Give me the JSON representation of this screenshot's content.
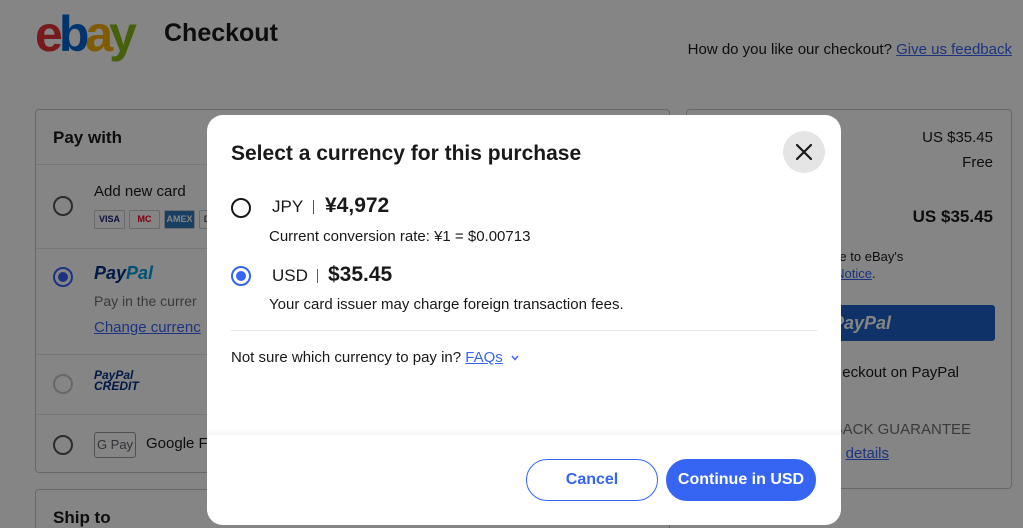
{
  "header": {
    "logo_letters": [
      "e",
      "b",
      "a",
      "y"
    ],
    "title": "Checkout",
    "feedback_prompt": "How do you like our checkout?",
    "feedback_link": "Give us feedback"
  },
  "pay_with": {
    "heading": "Pay with",
    "add_card_label": "Add new card",
    "card_brands": [
      "VISA",
      "MC",
      "AMEX",
      "DISC"
    ],
    "paypal_label_1": "Pay",
    "paypal_label_2": "Pal",
    "paypal_sub": "Pay in the currer",
    "paypal_change_link": "Change currenc",
    "paypal_credit_1": "PayPal",
    "paypal_credit_2": "CREDIT",
    "gpay_box": "G Pay",
    "gpay_label": "Google F"
  },
  "ship_to": {
    "heading": "Ship to"
  },
  "summary": {
    "subtotal": "US $35.45",
    "shipping": "Free",
    "total": "US $35.45",
    "agree_text": "r, you agree to eBay's",
    "agree_text_2": "d",
    "privacy_link": "Privacy Notice",
    "paypal_button": "PayPal",
    "paypal_note": "eckout on PayPal",
    "guarantee": "BACK GUARANTEE",
    "details_link": "details"
  },
  "modal": {
    "title": "Select a currency for this purchase",
    "options": [
      {
        "code": "JPY",
        "amount": "¥4,972",
        "note": "Current conversion rate: ¥1 = $0.00713",
        "selected": false
      },
      {
        "code": "USD",
        "amount": "$35.45",
        "note": "Your card issuer may charge foreign transaction fees.",
        "selected": true
      }
    ],
    "faq_prompt": "Not sure which currency to pay in?",
    "faq_link": "FAQs",
    "cancel_label": "Cancel",
    "continue_label": "Continue in USD"
  },
  "colors": {
    "accent": "#3665f3",
    "overlay": "rgba(0,0,0,0.48)",
    "paypal_dark": "#003087"
  }
}
